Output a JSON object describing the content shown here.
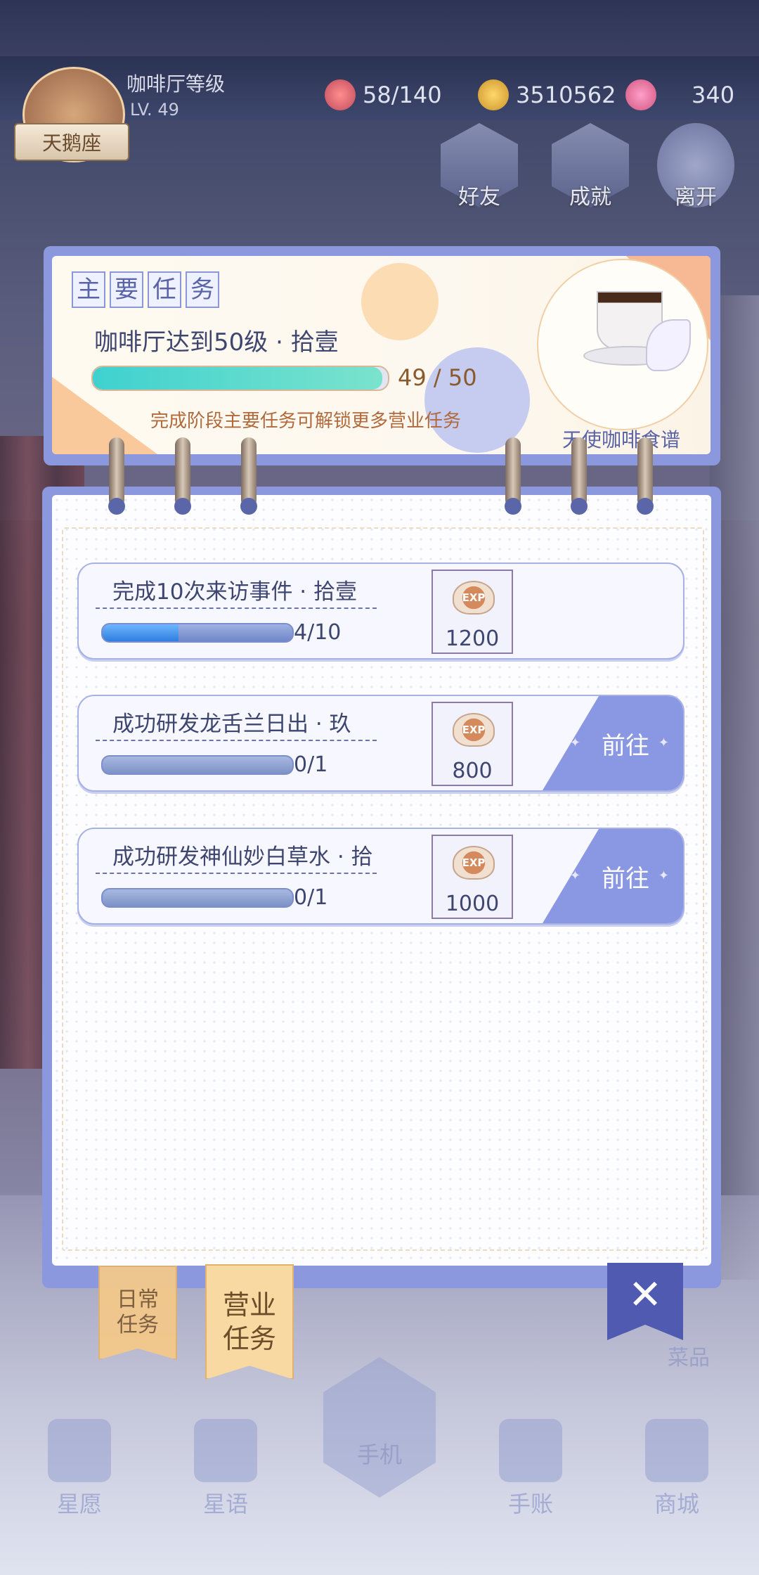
{
  "hud": {
    "badge_name": "天鹅座",
    "cafe_title": "咖啡厅等级",
    "cafe_level": "LV. 49",
    "energy": "58/140",
    "coins": "3510562",
    "swan": "340"
  },
  "top_buttons": {
    "friend": "好友",
    "achievement": "成就",
    "leave": "离开"
  },
  "main_task": {
    "tag_chars": [
      "主",
      "要",
      "任",
      "务"
    ],
    "title": "咖啡厅达到50级 · 拾壹",
    "progress_text": "49 / 50",
    "progress_fraction": 0.98,
    "hint": "完成阶段主要任务可解锁更多营业任务",
    "reward_name": "天使咖啡食谱"
  },
  "tasks": [
    {
      "title": "完成10次来访事件 · 拾壹",
      "progress_text": "4/10",
      "progress_fraction": 0.4,
      "reward_icon": "EXP",
      "reward_value": "1200",
      "go_label": ""
    },
    {
      "title": "成功研发龙舌兰日出 · 玖",
      "progress_text": "0/1",
      "progress_fraction": 0,
      "reward_icon": "EXP",
      "reward_value": "800",
      "go_label": "前往"
    },
    {
      "title": "成功研发神仙妙白草水 · 拾",
      "progress_text": "0/1",
      "progress_fraction": 0,
      "reward_icon": "EXP",
      "reward_value": "1000",
      "go_label": "前往"
    }
  ],
  "tabs": {
    "daily": "日常\n任务",
    "business": "营业\n任务"
  },
  "close_icon": "close-x-icon",
  "side_menu_label": "菜品",
  "nav": {
    "wish": "星愿",
    "star_language": "星语",
    "phone": "手机",
    "diary": "手账",
    "shop": "商城"
  }
}
